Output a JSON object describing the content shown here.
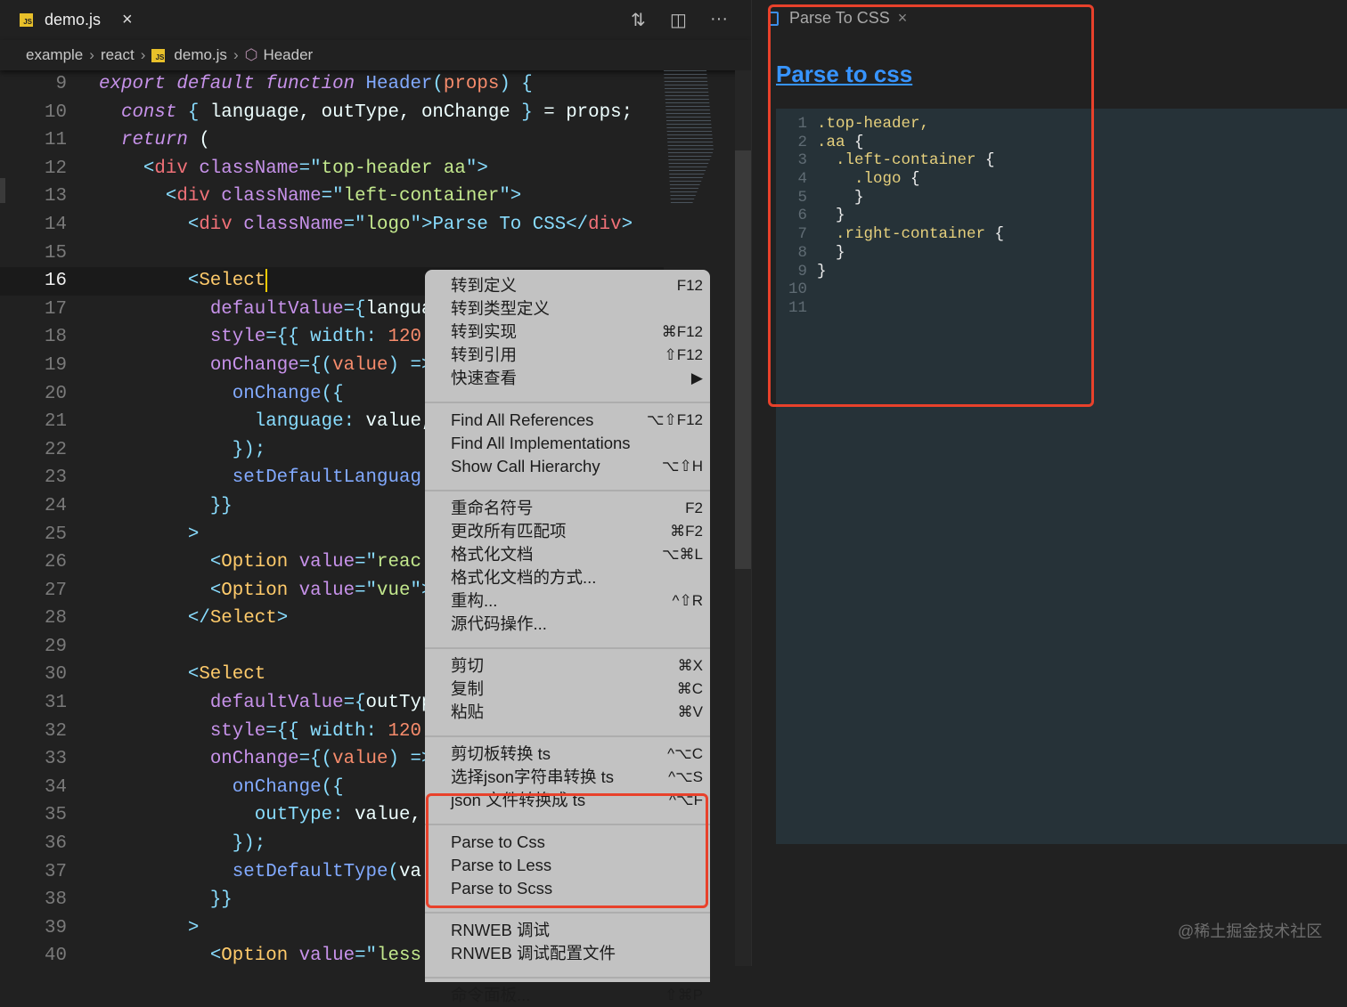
{
  "editor": {
    "tab": {
      "icon": "js-file-icon",
      "label": "demo.js"
    },
    "toolbar": {
      "compare_icon": "git-compare-icon",
      "split_icon": "split-editor-icon",
      "more_label": "···"
    },
    "breadcrumb": [
      "example",
      "react",
      "demo.js",
      "Header"
    ],
    "current_line": 16,
    "lines": [
      {
        "n": 9,
        "i": 0,
        "tk": [
          [
            "k",
            "export default function "
          ],
          [
            "f",
            "Header"
          ],
          [
            "c",
            "("
          ],
          [
            "p",
            "props"
          ],
          [
            "c",
            ")"
          ],
          [
            "w",
            " "
          ],
          [
            "c",
            "{"
          ]
        ]
      },
      {
        "n": 10,
        "i": 2,
        "tk": [
          [
            "k",
            "const "
          ],
          [
            "c",
            "{ "
          ],
          [
            "w",
            "language, outType, onChange "
          ],
          [
            "c",
            "}"
          ],
          [
            "w",
            " = props;"
          ]
        ]
      },
      {
        "n": 11,
        "i": 2,
        "tk": [
          [
            "k",
            "return "
          ],
          [
            "w",
            "("
          ]
        ]
      },
      {
        "n": 12,
        "i": 4,
        "tk": [
          [
            "c",
            "<"
          ],
          [
            "t",
            "div "
          ],
          [
            "a",
            "className"
          ],
          [
            "c",
            "=\""
          ],
          [
            "s",
            "top-header aa"
          ],
          [
            "c",
            "\">"
          ]
        ]
      },
      {
        "n": 13,
        "i": 6,
        "tk": [
          [
            "c",
            "<"
          ],
          [
            "t",
            "div "
          ],
          [
            "a",
            "className"
          ],
          [
            "c",
            "=\""
          ],
          [
            "s",
            "left-container"
          ],
          [
            "c",
            "\">"
          ]
        ]
      },
      {
        "n": 14,
        "i": 8,
        "tk": [
          [
            "c",
            "<"
          ],
          [
            "t",
            "div "
          ],
          [
            "a",
            "className"
          ],
          [
            "c",
            "=\""
          ],
          [
            "s",
            "logo"
          ],
          [
            "c",
            "\">"
          ],
          [
            "c",
            "Parse To CSS"
          ],
          [
            "c",
            "</"
          ],
          [
            "t",
            "div"
          ],
          [
            "c",
            ">"
          ]
        ]
      },
      {
        "n": 15,
        "i": 0,
        "tk": []
      },
      {
        "n": 16,
        "i": 8,
        "tk": [
          [
            "c",
            "<"
          ],
          [
            "y",
            "Select"
          ]
        ]
      },
      {
        "n": 17,
        "i": 10,
        "tk": [
          [
            "a",
            "defaultValue"
          ],
          [
            "c",
            "={"
          ],
          [
            "w",
            "langua"
          ]
        ]
      },
      {
        "n": 18,
        "i": 10,
        "tk": [
          [
            "a",
            "style"
          ],
          [
            "c",
            "={{ "
          ],
          [
            "c",
            "width"
          ],
          [
            "c",
            ": "
          ],
          [
            "n",
            "120"
          ]
        ]
      },
      {
        "n": 19,
        "i": 10,
        "tk": [
          [
            "a",
            "onChange"
          ],
          [
            "c",
            "={("
          ],
          [
            "p",
            "value"
          ],
          [
            "c",
            ") =>"
          ]
        ]
      },
      {
        "n": 20,
        "i": 12,
        "tk": [
          [
            "f",
            "onChange"
          ],
          [
            "c",
            "({"
          ]
        ]
      },
      {
        "n": 21,
        "i": 14,
        "tk": [
          [
            "c",
            "language"
          ],
          [
            "c",
            ": "
          ],
          [
            "w",
            "value,"
          ]
        ]
      },
      {
        "n": 22,
        "i": 12,
        "tk": [
          [
            "c",
            "});"
          ]
        ]
      },
      {
        "n": 23,
        "i": 12,
        "tk": [
          [
            "f",
            "setDefaultLanguag"
          ]
        ]
      },
      {
        "n": 24,
        "i": 10,
        "tk": [
          [
            "c",
            "}}"
          ]
        ]
      },
      {
        "n": 25,
        "i": 8,
        "tk": [
          [
            "c",
            ">"
          ]
        ]
      },
      {
        "n": 26,
        "i": 10,
        "tk": [
          [
            "c",
            "<"
          ],
          [
            "y",
            "Option "
          ],
          [
            "a",
            "value"
          ],
          [
            "c",
            "=\""
          ],
          [
            "s",
            "reac"
          ]
        ]
      },
      {
        "n": 27,
        "i": 10,
        "tk": [
          [
            "c",
            "<"
          ],
          [
            "y",
            "Option "
          ],
          [
            "a",
            "value"
          ],
          [
            "c",
            "=\""
          ],
          [
            "s",
            "vue"
          ],
          [
            "c",
            "\">"
          ]
        ]
      },
      {
        "n": 28,
        "i": 8,
        "tk": [
          [
            "c",
            "</"
          ],
          [
            "y",
            "Select"
          ],
          [
            "c",
            ">"
          ]
        ]
      },
      {
        "n": 29,
        "i": 0,
        "tk": []
      },
      {
        "n": 30,
        "i": 8,
        "tk": [
          [
            "c",
            "<"
          ],
          [
            "y",
            "Select"
          ]
        ]
      },
      {
        "n": 31,
        "i": 10,
        "tk": [
          [
            "a",
            "defaultValue"
          ],
          [
            "c",
            "={"
          ],
          [
            "w",
            "outTyp"
          ]
        ]
      },
      {
        "n": 32,
        "i": 10,
        "tk": [
          [
            "a",
            "style"
          ],
          [
            "c",
            "={{ "
          ],
          [
            "c",
            "width"
          ],
          [
            "c",
            ": "
          ],
          [
            "n",
            "120"
          ]
        ]
      },
      {
        "n": 33,
        "i": 10,
        "tk": [
          [
            "a",
            "onChange"
          ],
          [
            "c",
            "={("
          ],
          [
            "p",
            "value"
          ],
          [
            "c",
            ") =>"
          ]
        ]
      },
      {
        "n": 34,
        "i": 12,
        "tk": [
          [
            "f",
            "onChange"
          ],
          [
            "c",
            "({"
          ]
        ]
      },
      {
        "n": 35,
        "i": 14,
        "tk": [
          [
            "c",
            "outType"
          ],
          [
            "c",
            ": "
          ],
          [
            "w",
            "value,"
          ]
        ]
      },
      {
        "n": 36,
        "i": 12,
        "tk": [
          [
            "c",
            "});"
          ]
        ]
      },
      {
        "n": 37,
        "i": 12,
        "tk": [
          [
            "f",
            "setDefaultType"
          ],
          [
            "c",
            "("
          ],
          [
            "w",
            "va"
          ]
        ]
      },
      {
        "n": 38,
        "i": 10,
        "tk": [
          [
            "c",
            "}}"
          ]
        ]
      },
      {
        "n": 39,
        "i": 8,
        "tk": [
          [
            "c",
            ">"
          ]
        ]
      },
      {
        "n": 40,
        "i": 10,
        "tk": [
          [
            "c",
            "<"
          ],
          [
            "y",
            "Option "
          ],
          [
            "a",
            "value"
          ],
          [
            "c",
            "=\""
          ],
          [
            "s",
            "less"
          ]
        ]
      }
    ]
  },
  "context_menu": {
    "groups": [
      [
        {
          "label": "转到定义",
          "shortcut": "F12"
        },
        {
          "label": "转到类型定义",
          "shortcut": ""
        },
        {
          "label": "转到实现",
          "shortcut": "⌘F12"
        },
        {
          "label": "转到引用",
          "shortcut": "⇧F12"
        },
        {
          "label": "快速查看",
          "shortcut": "▶"
        }
      ],
      [
        {
          "label": "Find All References",
          "shortcut": "⌥⇧F12"
        },
        {
          "label": "Find All Implementations",
          "shortcut": ""
        },
        {
          "label": "Show Call Hierarchy",
          "shortcut": "⌥⇧H"
        }
      ],
      [
        {
          "label": "重命名符号",
          "shortcut": "F2"
        },
        {
          "label": "更改所有匹配项",
          "shortcut": "⌘F2"
        },
        {
          "label": "格式化文档",
          "shortcut": "⌥⌘L"
        },
        {
          "label": "格式化文档的方式...",
          "shortcut": ""
        },
        {
          "label": "重构...",
          "shortcut": "^⇧R"
        },
        {
          "label": "源代码操作...",
          "shortcut": ""
        }
      ],
      [
        {
          "label": "剪切",
          "shortcut": "⌘X"
        },
        {
          "label": "复制",
          "shortcut": "⌘C"
        },
        {
          "label": "粘贴",
          "shortcut": "⌘V"
        }
      ],
      [
        {
          "label": "剪切板转换 ts",
          "shortcut": "^⌥C"
        },
        {
          "label": "选择json字符串转换 ts",
          "shortcut": "^⌥S"
        },
        {
          "label": "json 文件转换成 ts",
          "shortcut": "^⌥F"
        }
      ],
      [
        {
          "label": "Parse to Css",
          "shortcut": ""
        },
        {
          "label": "Parse to Less",
          "shortcut": ""
        },
        {
          "label": "Parse to Scss",
          "shortcut": ""
        }
      ],
      [
        {
          "label": "RNWEB 调试",
          "shortcut": ""
        },
        {
          "label": "RNWEB 调试配置文件",
          "shortcut": ""
        }
      ],
      [
        {
          "label": "命令面板...",
          "shortcut": "⇧⌘P"
        }
      ]
    ]
  },
  "preview": {
    "tab_label": "Parse To CSS",
    "heading": "Parse to css",
    "lines": [
      {
        "n": "1",
        "text": ".top-header,",
        "brace": ""
      },
      {
        "n": "2",
        "text": ".aa ",
        "brace": "{"
      },
      {
        "n": "3",
        "text": "  .left-container ",
        "brace": "{"
      },
      {
        "n": "4",
        "text": "    .logo ",
        "brace": "{"
      },
      {
        "n": "5",
        "text": "    ",
        "brace": "}"
      },
      {
        "n": "6",
        "text": "  ",
        "brace": "}"
      },
      {
        "n": "7",
        "text": "  .right-container ",
        "brace": "{"
      },
      {
        "n": "8",
        "text": "  ",
        "brace": "}"
      },
      {
        "n": "9",
        "text": "",
        "brace": "}"
      },
      {
        "n": "10",
        "text": "",
        "brace": ""
      },
      {
        "n": "11",
        "text": "",
        "brace": ""
      }
    ]
  },
  "watermark": "@稀土掘金技术社区",
  "colors": {
    "highlight_box": "#e8412b",
    "link": "#3794ff",
    "menu_bg": "#c2c2c2"
  }
}
